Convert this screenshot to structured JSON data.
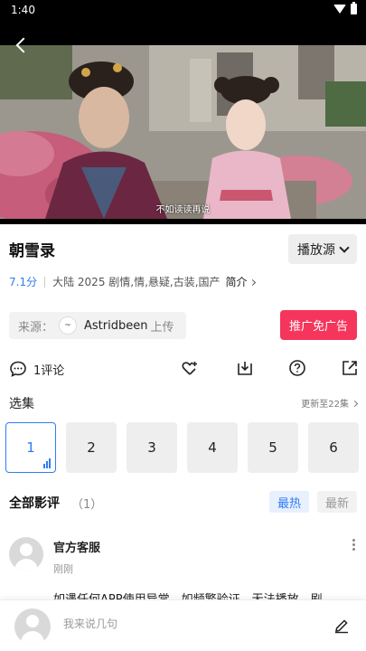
{
  "status_bar": {
    "time": "1:40",
    "icons": [
      "wifi-icon",
      "battery-icon"
    ]
  },
  "player": {
    "subtitle": "不如读读再说",
    "back_icon": "back-arrow-icon"
  },
  "show": {
    "title": "朝雪录",
    "source_button": "播放源",
    "rating": "7.1分",
    "meta": "大陆  2025  剧情,情,悬疑,古装,国产",
    "intro_link": "简介"
  },
  "uploader": {
    "label": "来源：",
    "avatar_text": "~",
    "name": "Astridbeen",
    "suffix": "上传"
  },
  "ad_button": "推广免广告",
  "actions": {
    "comment_count": "1评论",
    "icons": [
      "comment-icon",
      "favorite-heart-icon",
      "download-icon",
      "help-icon",
      "share-icon"
    ]
  },
  "episodes": {
    "title": "选集",
    "update_status": "更新至22集",
    "items": [
      "1",
      "2",
      "3",
      "4",
      "5",
      "6"
    ],
    "active_index": 0
  },
  "reviews": {
    "title": "全部影评",
    "count": "（1）",
    "sort_hot": "最热",
    "sort_new": "最新",
    "items": [
      {
        "user": "官方客服",
        "time": "刚刚",
        "text": "如遇任何APP使用异常，如频繁验证，无法播放，剧"
      }
    ]
  },
  "comment_input": {
    "placeholder": "我来说几句"
  },
  "colors": {
    "accent_blue": "#2f7cf6",
    "ad_red": "#f5355b"
  }
}
